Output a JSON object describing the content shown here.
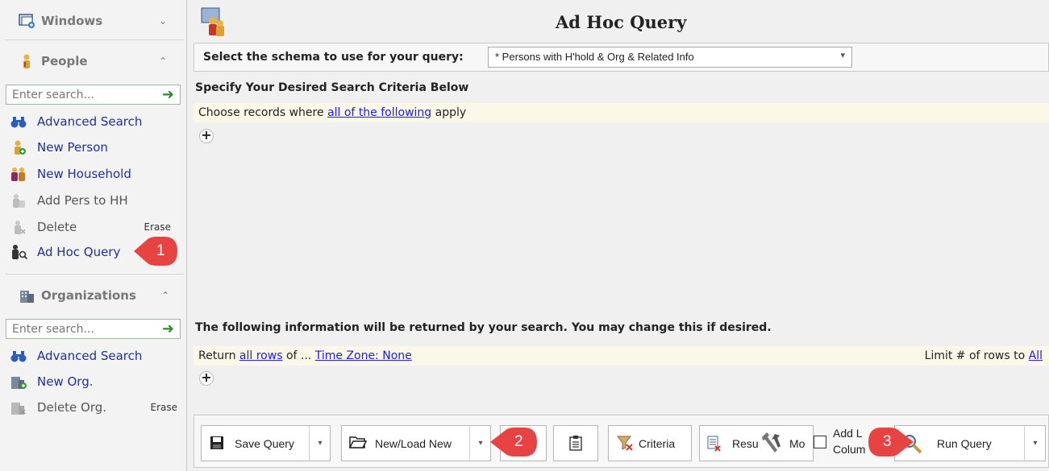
{
  "sidebar": {
    "windows_label": "Windows",
    "people_label": "People",
    "people_search_placeholder": "Enter search...",
    "people_items": [
      {
        "label": "Advanced Search",
        "shortcut": ""
      },
      {
        "label": "New Person",
        "shortcut": ""
      },
      {
        "label": "New Household",
        "shortcut": ""
      },
      {
        "label": "Add Pers to HH",
        "shortcut": ""
      },
      {
        "label": "Delete",
        "shortcut": "Erase"
      },
      {
        "label": "Ad Hoc Query",
        "shortcut": ""
      }
    ],
    "orgs_label": "Organizations",
    "orgs_search_placeholder": "Enter search...",
    "org_items": [
      {
        "label": "Advanced Search",
        "shortcut": ""
      },
      {
        "label": "New Org.",
        "shortcut": ""
      },
      {
        "label": "Delete Org.",
        "shortcut": "Erase"
      }
    ]
  },
  "main": {
    "title": "Ad Hoc Query",
    "schema_label": "Select the schema to use for your query:",
    "schema_value": "* Persons with H'hold & Org & Related Info",
    "criteria_heading": "Specify Your Desired Search Criteria Below",
    "criteria_prefix": "Choose records where",
    "criteria_link": "all of the following",
    "criteria_suffix": "apply",
    "return_heading": "The following information will be returned by your search. You may change this if desired.",
    "return_prefix": "Return",
    "return_rows_link": "all rows",
    "return_of": "of ...",
    "timezone_link": "Time Zone: None",
    "limit_label": "Limit # of rows to",
    "limit_link": "All"
  },
  "toolbar": {
    "save_query": "Save Query",
    "new_load": "New/Load New",
    "criteria": "Criteria",
    "results": "Resu",
    "mo": "Mo",
    "add_label_1": "Add L",
    "add_label_2": "Colum",
    "run_query": "Run Query"
  },
  "callouts": [
    "1",
    "2",
    "3"
  ],
  "colors": {
    "callout": "#e84343",
    "link": "#1a1aee",
    "nav_text": "#1f2f9c"
  }
}
